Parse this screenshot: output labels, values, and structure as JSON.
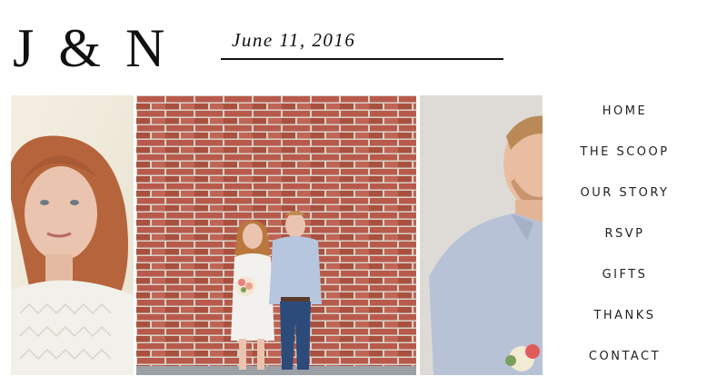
{
  "header": {
    "logo": "J & N",
    "date": "June 11, 2016"
  },
  "nav": {
    "items": [
      {
        "label": "HOME"
      },
      {
        "label": "THE SCOOP"
      },
      {
        "label": "OUR STORY"
      },
      {
        "label": "RSVP"
      },
      {
        "label": "GIFTS"
      },
      {
        "label": "THANKS"
      },
      {
        "label": "CONTACT"
      }
    ]
  },
  "photos": [
    {
      "subject": "bride-portrait"
    },
    {
      "subject": "couple-brick-wall"
    },
    {
      "subject": "groom-portrait"
    }
  ],
  "colors": {
    "text": "#111111",
    "brick": "#b5584a",
    "mortar": "#d9d3c9"
  }
}
